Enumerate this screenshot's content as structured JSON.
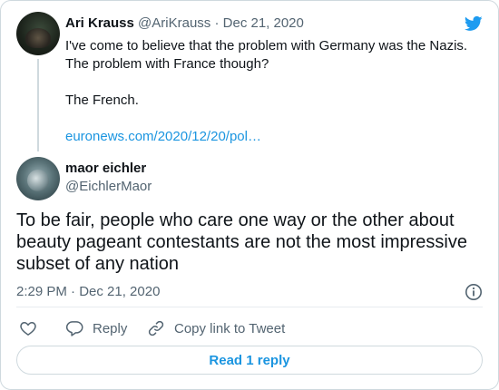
{
  "quoted_tweet": {
    "author_name": "Ari Krauss",
    "handle": "@AriKrauss",
    "separator": "·",
    "date": "Dec 21, 2020",
    "line1": "I've come to believe that the problem with Germany was the Nazis.",
    "line2": "The problem with France though?",
    "line3": "The French.",
    "link": "euronews.com/2020/12/20/pol…"
  },
  "tweet": {
    "author_name": "maor eichler",
    "handle": "@EichlerMaor",
    "text": "To be fair, people who care one way or the other about beauty pageant contestants are not the most impressive subset of any nation",
    "timestamp": "2:29 PM · Dec 21, 2020"
  },
  "actions": {
    "reply_label": "Reply",
    "copy_link_label": "Copy link to Tweet"
  },
  "read_replies_label": "Read 1 reply",
  "colors": {
    "twitter_blue": "#1d9bf0",
    "link_blue": "#1b95e0",
    "secondary_text": "#536471",
    "border": "#cfd9de"
  },
  "icons": [
    "twitter-logo-icon",
    "info-icon",
    "heart-icon",
    "reply-icon",
    "link-icon"
  ]
}
